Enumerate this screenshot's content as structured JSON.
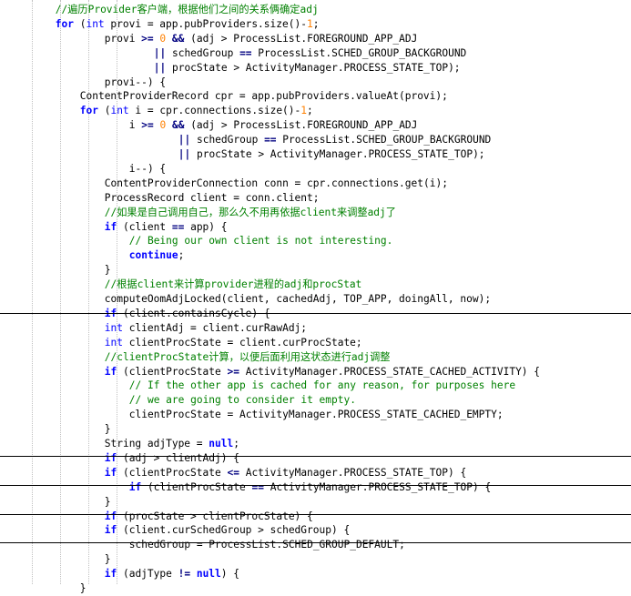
{
  "code_lines": [
    {
      "indent": 9,
      "tokens": [
        [
          "cm",
          "//遍历Provider客户端，根据他们之间的关系俩确定adj"
        ]
      ]
    },
    {
      "indent": 9,
      "tokens": [
        [
          "kw",
          "for"
        ],
        [
          "txt",
          " ("
        ],
        [
          "type",
          "int"
        ],
        [
          "txt",
          " provi = app.pubProviders.size()-"
        ],
        [
          "num",
          "1"
        ],
        [
          "txt",
          ";"
        ]
      ]
    },
    {
      "indent": 17,
      "tokens": [
        [
          "txt",
          "provi "
        ],
        [
          "op",
          ">="
        ],
        [
          "txt",
          " "
        ],
        [
          "num",
          "0"
        ],
        [
          "txt",
          " "
        ],
        [
          "op",
          "&&"
        ],
        [
          "txt",
          " (adj > ProcessList.FOREGROUND_APP_ADJ"
        ]
      ]
    },
    {
      "indent": 25,
      "tokens": [
        [
          "op",
          "||"
        ],
        [
          "txt",
          " schedGroup "
        ],
        [
          "op",
          "=="
        ],
        [
          "txt",
          " ProcessList.SCHED_GROUP_BACKGROUND"
        ]
      ]
    },
    {
      "indent": 25,
      "tokens": [
        [
          "op",
          "||"
        ],
        [
          "txt",
          " procState > ActivityManager.PROCESS_STATE_TOP);"
        ]
      ]
    },
    {
      "indent": 17,
      "tokens": [
        [
          "txt",
          "provi--) {"
        ]
      ]
    },
    {
      "indent": 13,
      "tokens": [
        [
          "txt",
          "ContentProviderRecord cpr = app.pubProviders.valueAt(provi);"
        ]
      ]
    },
    {
      "indent": 13,
      "tokens": [
        [
          "kw",
          "for"
        ],
        [
          "txt",
          " ("
        ],
        [
          "type",
          "int"
        ],
        [
          "txt",
          " i = cpr.connections.size()-"
        ],
        [
          "num",
          "1"
        ],
        [
          "txt",
          ";"
        ]
      ]
    },
    {
      "indent": 21,
      "tokens": [
        [
          "txt",
          "i "
        ],
        [
          "op",
          ">="
        ],
        [
          "txt",
          " "
        ],
        [
          "num",
          "0"
        ],
        [
          "txt",
          " "
        ],
        [
          "op",
          "&&"
        ],
        [
          "txt",
          " (adj > ProcessList.FOREGROUND_APP_ADJ"
        ]
      ]
    },
    {
      "indent": 29,
      "tokens": [
        [
          "op",
          "||"
        ],
        [
          "txt",
          " schedGroup "
        ],
        [
          "op",
          "=="
        ],
        [
          "txt",
          " ProcessList.SCHED_GROUP_BACKGROUND"
        ]
      ]
    },
    {
      "indent": 29,
      "tokens": [
        [
          "op",
          "||"
        ],
        [
          "txt",
          " procState > ActivityManager.PROCESS_STATE_TOP);"
        ]
      ]
    },
    {
      "indent": 21,
      "tokens": [
        [
          "txt",
          "i--) {"
        ]
      ]
    },
    {
      "indent": 17,
      "tokens": [
        [
          "txt",
          "ContentProviderConnection conn = cpr.connections.get(i);"
        ]
      ]
    },
    {
      "indent": 17,
      "tokens": [
        [
          "txt",
          "ProcessRecord client = conn.client;"
        ]
      ]
    },
    {
      "indent": 17,
      "tokens": [
        [
          "cm",
          "//如果是自己调用自己，那么久不用再依据client来调整adj了"
        ]
      ]
    },
    {
      "indent": 17,
      "tokens": [
        [
          "kw",
          "if"
        ],
        [
          "txt",
          " (client "
        ],
        [
          "op",
          "=="
        ],
        [
          "txt",
          " app) {"
        ]
      ]
    },
    {
      "indent": 21,
      "tokens": [
        [
          "cm",
          "// Being our own client is not interesting."
        ]
      ]
    },
    {
      "indent": 21,
      "tokens": [
        [
          "kw",
          "continue"
        ],
        [
          "txt",
          ";"
        ]
      ]
    },
    {
      "indent": 17,
      "tokens": [
        [
          "txt",
          "}"
        ]
      ]
    },
    {
      "indent": 17,
      "tokens": [
        [
          "cm",
          "//根据client来计算provider进程的adj和procStat"
        ]
      ]
    },
    {
      "indent": 17,
      "tokens": [
        [
          "txt",
          "computeOomAdjLocked(client, cachedAdj, TOP_APP, doingAll, now);"
        ]
      ]
    },
    {
      "indent": 17,
      "tokens": [
        [
          "kw",
          "if"
        ],
        [
          "txt",
          " (client.containsCycle) {"
        ]
      ]
    },
    {
      "indent": 17,
      "tokens": [
        [
          "type",
          "int"
        ],
        [
          "txt",
          " clientAdj = client.curRawAdj;"
        ]
      ]
    },
    {
      "indent": 17,
      "tokens": [
        [
          "type",
          "int"
        ],
        [
          "txt",
          " clientProcState = client.curProcState;"
        ]
      ]
    },
    {
      "indent": 17,
      "tokens": [
        [
          "cm",
          "//clientProcState计算，以便后面利用这状态进行adj调整"
        ]
      ]
    },
    {
      "indent": 17,
      "tokens": [
        [
          "kw",
          "if"
        ],
        [
          "txt",
          " (clientProcState "
        ],
        [
          "op",
          ">="
        ],
        [
          "txt",
          " ActivityManager.PROCESS_STATE_CACHED_ACTIVITY) {"
        ]
      ]
    },
    {
      "indent": 21,
      "tokens": [
        [
          "cm",
          "// If the other app is cached for any reason, for purposes here"
        ]
      ]
    },
    {
      "indent": 21,
      "tokens": [
        [
          "cm",
          "// we are going to consider it empty."
        ]
      ]
    },
    {
      "indent": 21,
      "tokens": [
        [
          "txt",
          "clientProcState = ActivityManager.PROCESS_STATE_CACHED_EMPTY;"
        ]
      ]
    },
    {
      "indent": 17,
      "tokens": [
        [
          "txt",
          "}"
        ]
      ]
    },
    {
      "indent": 17,
      "tokens": [
        [
          "txt",
          "String adjType = "
        ],
        [
          "kw",
          "null"
        ],
        [
          "txt",
          ";"
        ]
      ]
    },
    {
      "indent": 17,
      "tokens": [
        [
          "kw",
          "if"
        ],
        [
          "txt",
          " (adj > clientAdj) {"
        ]
      ]
    },
    {
      "indent": 17,
      "tokens": [
        [
          "kw",
          "if"
        ],
        [
          "txt",
          " (clientProcState "
        ],
        [
          "op",
          "<="
        ],
        [
          "txt",
          " ActivityManager.PROCESS_STATE_TOP) {"
        ]
      ]
    },
    {
      "indent": 21,
      "tokens": [
        [
          "kw",
          "if"
        ],
        [
          "txt",
          " (clientProcState "
        ],
        [
          "op",
          "=="
        ],
        [
          "txt",
          " ActivityManager.PROCESS_STATE_TOP) {"
        ]
      ]
    },
    {
      "indent": 17,
      "tokens": [
        [
          "txt",
          "}"
        ]
      ]
    },
    {
      "indent": 17,
      "tokens": [
        [
          "kw",
          "if"
        ],
        [
          "txt",
          " (procState > clientProcState) {"
        ]
      ]
    },
    {
      "indent": 17,
      "tokens": [
        [
          "kw",
          "if"
        ],
        [
          "txt",
          " (client.curSchedGroup > schedGroup) {"
        ]
      ]
    },
    {
      "indent": 21,
      "tokens": [
        [
          "txt",
          "schedGroup = ProcessList.SCHED_GROUP_DEFAULT;"
        ]
      ]
    },
    {
      "indent": 17,
      "tokens": [
        [
          "txt",
          "}"
        ]
      ]
    },
    {
      "indent": 17,
      "tokens": [
        [
          "kw",
          "if"
        ],
        [
          "txt",
          " (adjType "
        ],
        [
          "op",
          "!="
        ],
        [
          "txt",
          " "
        ],
        [
          "kw",
          "null"
        ],
        [
          "txt",
          ") {"
        ]
      ]
    },
    {
      "indent": 13,
      "tokens": [
        [
          "txt",
          "}"
        ]
      ]
    }
  ]
}
